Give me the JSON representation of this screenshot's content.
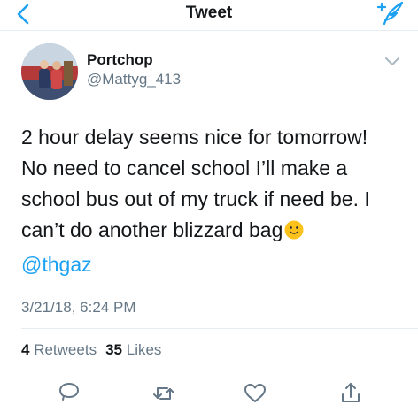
{
  "nav": {
    "title": "Tweet",
    "back_icon": "chevron-left-icon",
    "compose_icon": "compose-tweet-icon"
  },
  "author": {
    "name": "Portchop",
    "handle": "@Mattyg_413"
  },
  "tweet": {
    "lines": [
      "2 hour delay seems nice for tomorrow!",
      "No need to cancel school I’ll make a",
      "school bus out of my truck if need be. I",
      "can’t do another blizzard bag"
    ],
    "emoji": "slightly-smiling-face",
    "mention": "@thgaz",
    "timestamp": "3/21/18, 6:24 PM"
  },
  "stats": {
    "retweets_count": "4",
    "retweets_label": "Retweets",
    "likes_count": "35",
    "likes_label": "Likes"
  },
  "actions": [
    "reply-icon",
    "retweet-icon",
    "like-icon",
    "share-icon"
  ],
  "colors": {
    "accent": "#1da1f2",
    "text": "#14171a",
    "secondary": "#657786",
    "divider": "#e6ecf0"
  }
}
